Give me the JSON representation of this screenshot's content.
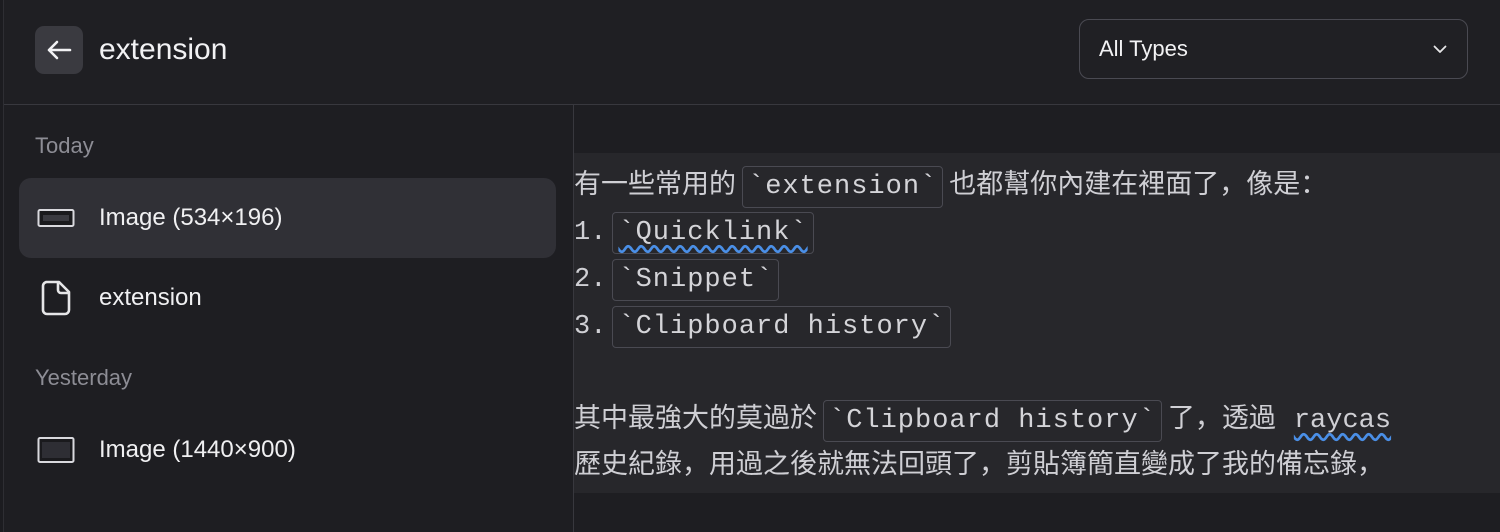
{
  "header": {
    "back_icon": "arrow-left-icon",
    "search_value": "extension",
    "type_filter": "All Types"
  },
  "sidebar": {
    "sections": [
      {
        "title": "Today",
        "items": [
          {
            "icon": "image-icon",
            "label": "Image (534×196)",
            "selected": true
          },
          {
            "icon": "file-icon",
            "label": "extension",
            "selected": false
          }
        ]
      },
      {
        "title": "Yesterday",
        "items": [
          {
            "icon": "image-icon",
            "label": "Image (1440×900)",
            "selected": false
          }
        ]
      }
    ]
  },
  "preview": {
    "line1_pre": "有一些常用的",
    "line1_code": "`extension`",
    "line1_post": "也都幫你內建在裡面了，像是：",
    "item1_num": "1.",
    "item1_code": "`Quicklink`",
    "item2_num": "2.",
    "item2_code": "`Snippet`",
    "item3_num": "3.",
    "item3_code": "`Clipboard history`",
    "line5_pre": "其中最強大的莫過於",
    "line5_code": "`Clipboard history`",
    "line5_mid": "了，透過",
    "line5_post": "raycas",
    "line6": "歷史紀錄，用過之後就無法回頭了，剪貼簿簡直變成了我的備忘錄，"
  },
  "colors": {
    "background": "#1e1e22",
    "selected_row": "#303036",
    "preview_bg": "#27272b",
    "spell_underline": "#4a8fe7"
  }
}
